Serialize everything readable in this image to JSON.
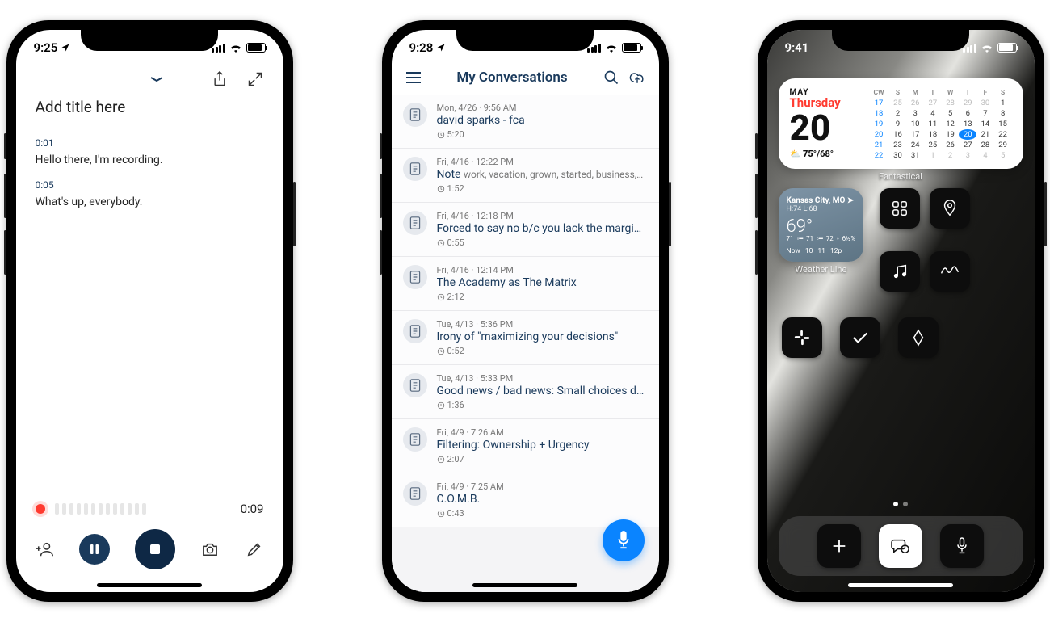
{
  "screen1": {
    "status_time": "9:25",
    "toolbar": {},
    "title_placeholder": "Add title here",
    "lines": [
      {
        "ts": "0:01",
        "text": "Hello there, I'm recording."
      },
      {
        "ts": "0:05",
        "text": "What's up, everybody."
      }
    ],
    "elapsed": "0:09"
  },
  "screen2": {
    "status_time": "9:28",
    "header_title": "My Conversations",
    "items": [
      {
        "meta": "Mon, 4/26 · 9:56 AM",
        "title": "david sparks - fca",
        "sub": "",
        "dur": "5:20"
      },
      {
        "meta": "Fri, 4/16 · 12:22 PM",
        "title": "Note",
        "sub": "work, vacation, grown, started, business,…",
        "dur": "1:52"
      },
      {
        "meta": "Fri, 4/16 · 12:18 PM",
        "title": "Forced to say no b/c you lack the margi…",
        "sub": "",
        "dur": "0:55"
      },
      {
        "meta": "Fri, 4/16 · 12:14 PM",
        "title": "The Academy as The Matrix",
        "sub": "",
        "dur": "2:12"
      },
      {
        "meta": "Tue, 4/13 · 5:36 PM",
        "title": "Irony of \"maximizing your decisions\"",
        "sub": "",
        "dur": "0:52"
      },
      {
        "meta": "Tue, 4/13 · 5:33 PM",
        "title": "Good news / bad news: Small choices d…",
        "sub": "",
        "dur": "1:36"
      },
      {
        "meta": "Fri, 4/9 · 7:26 AM",
        "title": "Filtering: Ownership + Urgency",
        "sub": "",
        "dur": "2:07"
      },
      {
        "meta": "Fri, 4/9 · 7:25 AM",
        "title": "C.O.M.B.",
        "sub": "",
        "dur": "0:43"
      }
    ]
  },
  "screen3": {
    "status_time": "9:41",
    "calendar": {
      "month": "MAY",
      "dayname": "Thursday",
      "daynum": "20",
      "temp_hi": "75°",
      "temp_lo": "/68°",
      "head": [
        "CW",
        "S",
        "M",
        "T",
        "W",
        "T",
        "F",
        "S"
      ],
      "rows": [
        [
          "17",
          "25",
          "26",
          "27",
          "28",
          "29",
          "30",
          "1"
        ],
        [
          "18",
          "2",
          "3",
          "4",
          "5",
          "6",
          "7",
          "8"
        ],
        [
          "19",
          "9",
          "10",
          "11",
          "12",
          "13",
          "14",
          "15"
        ],
        [
          "20",
          "16",
          "17",
          "18",
          "19",
          "20",
          "21",
          "22"
        ],
        [
          "21",
          "23",
          "24",
          "25",
          "26",
          "27",
          "28",
          "29"
        ],
        [
          "22",
          "30",
          "31",
          "1",
          "2",
          "3",
          "4",
          "5"
        ]
      ],
      "caption": "Fantastical"
    },
    "weather": {
      "location": "Kansas City, MO",
      "hl": "H:74 L:68",
      "now_temp": "69°",
      "trend": [
        "71",
        "71",
        "72"
      ],
      "trend_pct": "6½%",
      "hours": [
        "Now",
        "10",
        "11",
        "12p"
      ],
      "caption": "Weather Line"
    }
  }
}
